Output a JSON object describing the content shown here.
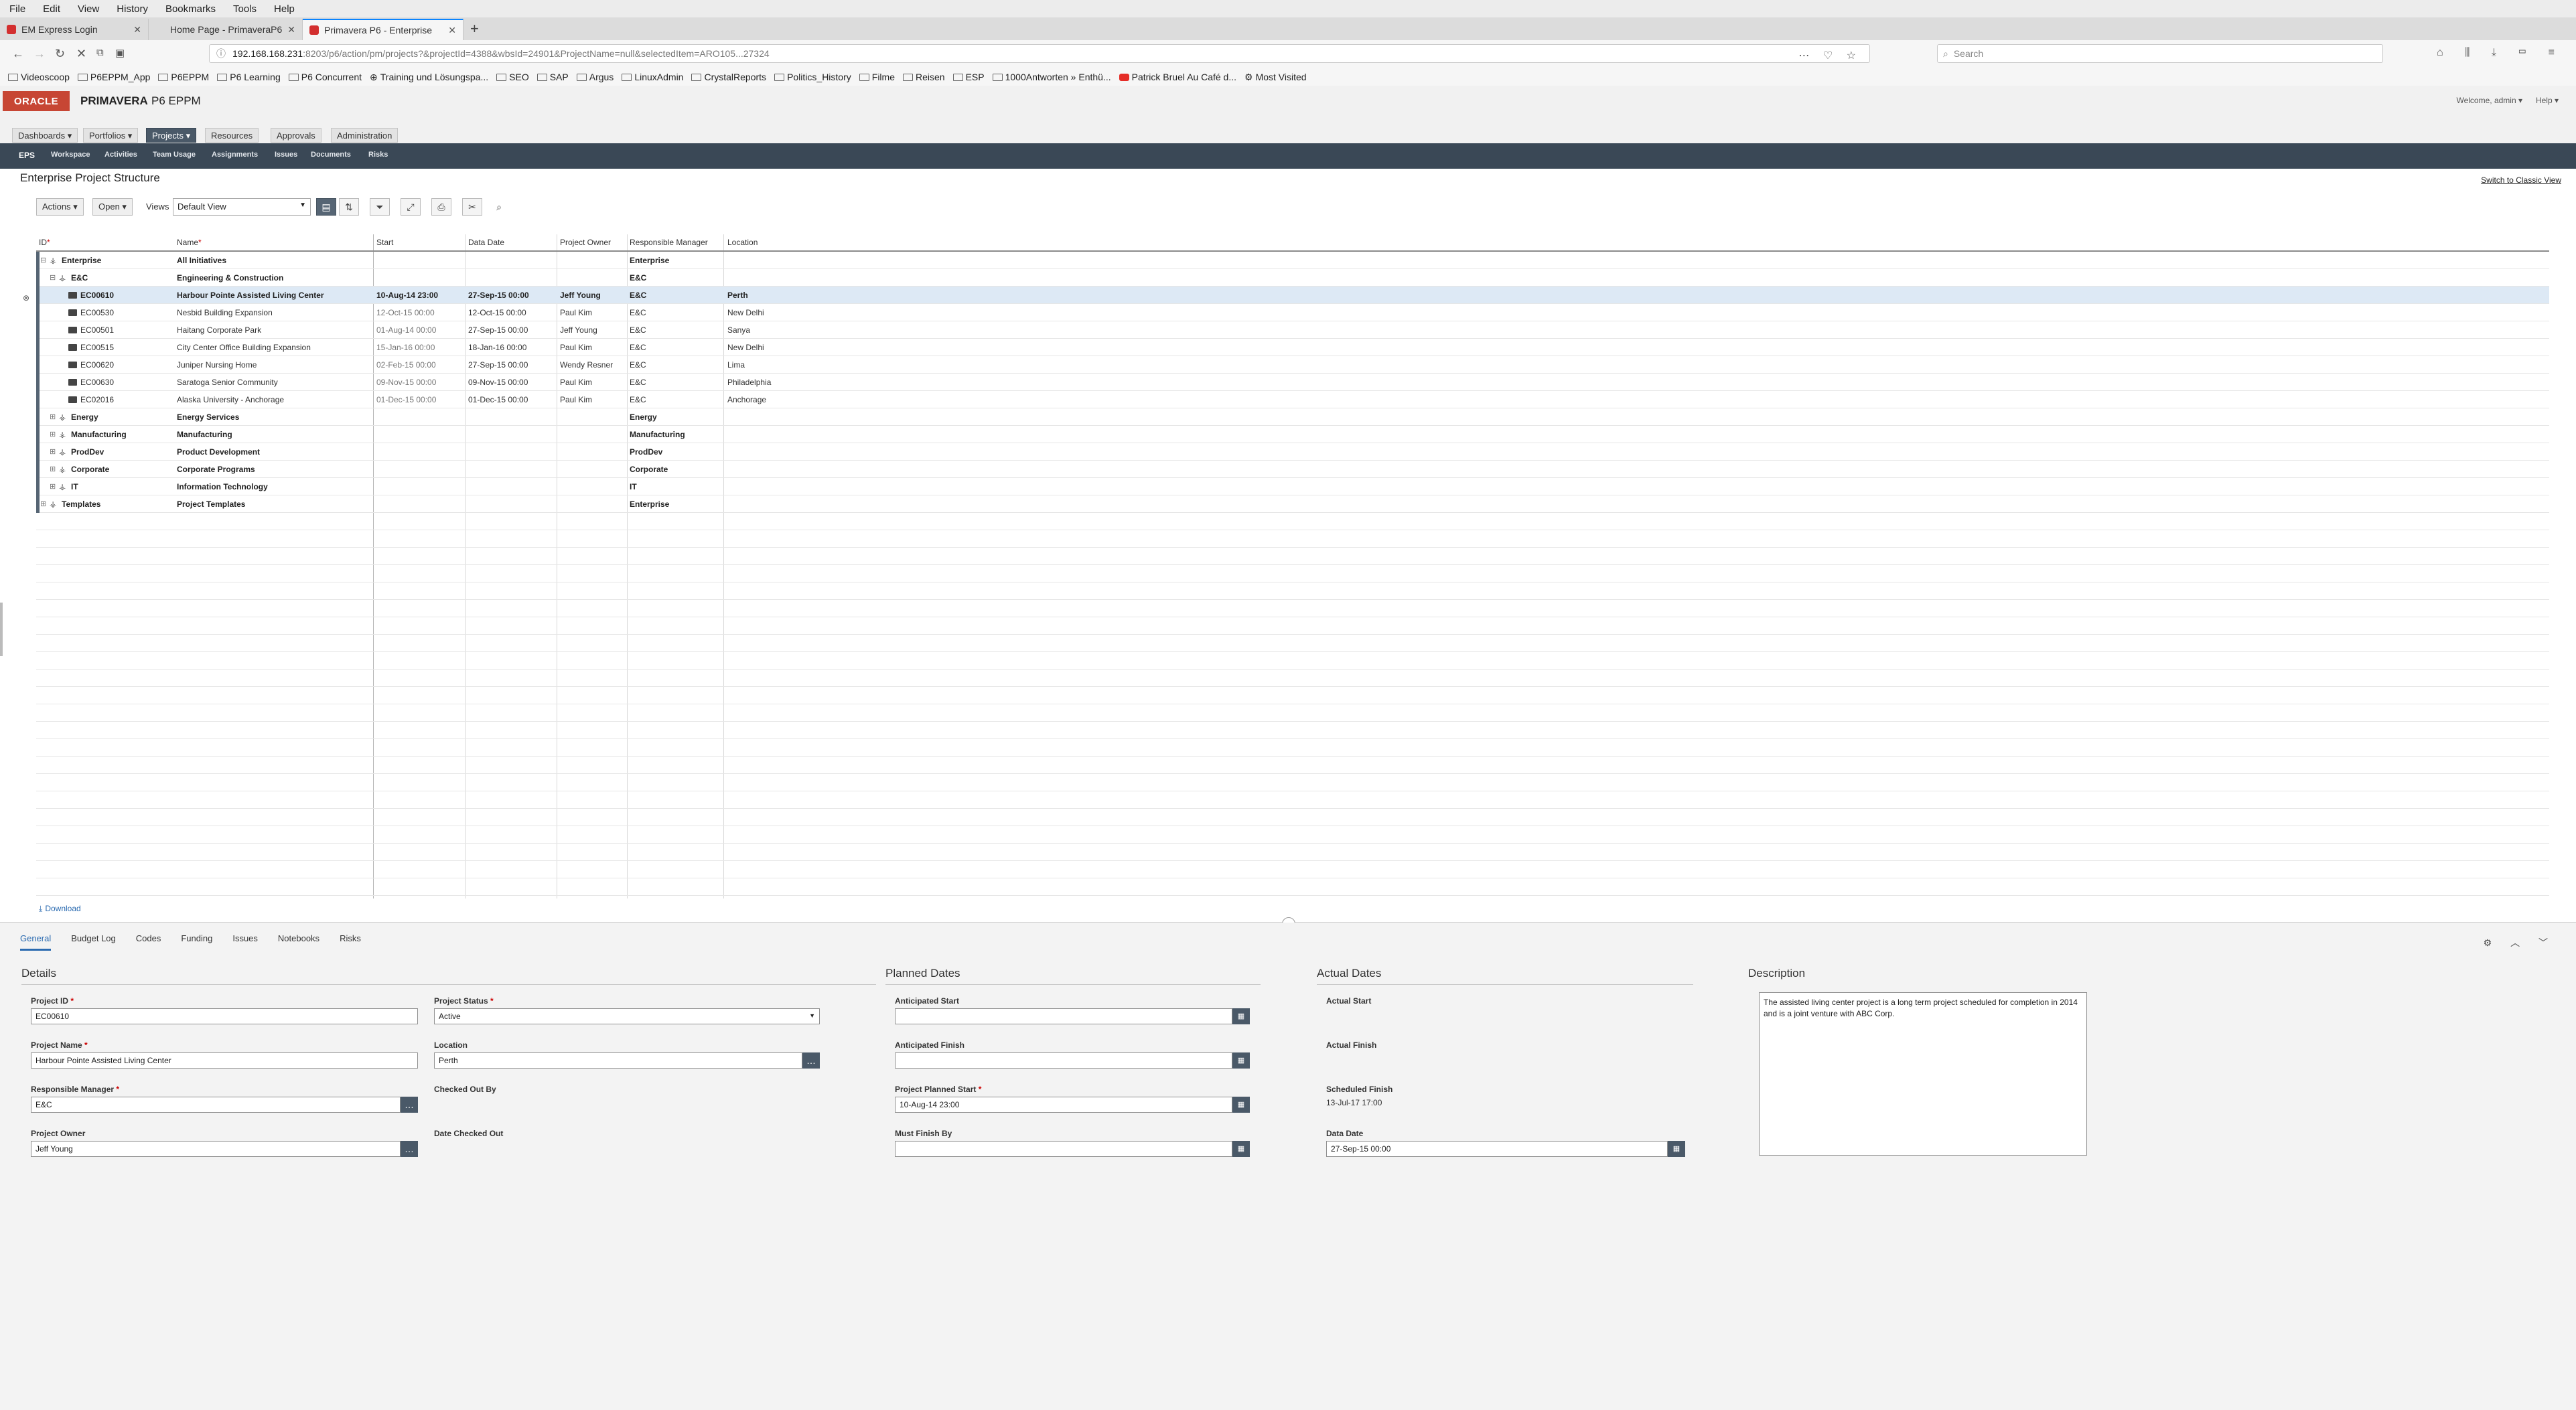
{
  "browser": {
    "menu": [
      "File",
      "Edit",
      "View",
      "History",
      "Bookmarks",
      "Tools",
      "Help"
    ],
    "tabs": [
      {
        "title": "EM Express Login",
        "active": false
      },
      {
        "title": "Home Page - PrimaveraP6EPPM",
        "active": false
      },
      {
        "title": "Primavera P6 - Enterprise",
        "active": true
      }
    ],
    "url_host": "192.168.168.231",
    "url_path": ":8203/p6/action/pm/projects?&projectId=4388&wbsId=24901&ProjectName=null&selectedItem=ARO105...27324",
    "search_placeholder": "Search",
    "bookmarks": [
      "Videoscoop",
      "P6EPPM_App",
      "P6EPPM",
      "P6 Learning",
      "P6 Concurrent",
      "Training und Lösungspa...",
      "SEO",
      "SAP",
      "Argus",
      "LinuxAdmin",
      "CrystalReports",
      "Politics_History",
      "Filme",
      "Reisen",
      "ESP",
      "1000Antworten » Enthü...",
      "Patrick Bruel Au Café d...",
      "Most Visited"
    ]
  },
  "app": {
    "logo": "ORACLE",
    "product_name": "PRIMAVERA",
    "product_edition": "P6 EPPM",
    "welcome": "Welcome, admin ▾",
    "help": "Help ▾",
    "modules": [
      "Dashboards ▾",
      "Portfolios ▾",
      "Projects ▾",
      "Resources",
      "Approvals",
      "Administration"
    ],
    "subnav": [
      "EPS",
      "Workspace",
      "Activities",
      "Team Usage",
      "Assignments",
      "Issues",
      "Documents",
      "Risks"
    ]
  },
  "eps": {
    "title": "Enterprise Project Structure",
    "classic_link": "Switch to Classic View",
    "actions": "Actions ▾",
    "open": "Open ▾",
    "views_label": "Views",
    "view_selected": "Default View",
    "columns": [
      {
        "label": "ID",
        "required": true
      },
      {
        "label": "Name",
        "required": true
      },
      {
        "label": "Start",
        "required": false
      },
      {
        "label": "Data Date",
        "required": false
      },
      {
        "label": "Project Owner",
        "required": false
      },
      {
        "label": "Responsible Manager",
        "required": false
      },
      {
        "label": "Location",
        "required": false
      }
    ],
    "rows": [
      {
        "level": 0,
        "type": "eps",
        "toggle": "⊟",
        "id": "Enterprise",
        "name": "All Initiatives",
        "start": "",
        "data_date": "",
        "owner": "",
        "manager": "Enterprise",
        "location": "",
        "bold": true
      },
      {
        "level": 1,
        "type": "eps",
        "toggle": "⊟",
        "id": "E&C",
        "name": "Engineering & Construction",
        "start": "",
        "data_date": "",
        "owner": "",
        "manager": "E&C",
        "location": "",
        "bold": true
      },
      {
        "level": 2,
        "type": "project",
        "toggle": "",
        "id": "EC00610",
        "name": "Harbour Pointe Assisted Living Center",
        "start": "10-Aug-14 23:00",
        "data_date": "27-Sep-15 00:00",
        "owner": "Jeff Young",
        "manager": "E&C",
        "location": "Perth",
        "bold": true,
        "selected": true
      },
      {
        "level": 2,
        "type": "project",
        "toggle": "",
        "id": "EC00530",
        "name": "Nesbid Building Expansion",
        "start": "12-Oct-15 00:00",
        "data_date": "12-Oct-15 00:00",
        "owner": "Paul Kim",
        "manager": "E&C",
        "location": "New Delhi"
      },
      {
        "level": 2,
        "type": "project",
        "toggle": "",
        "id": "EC00501",
        "name": "Haitang Corporate Park",
        "start": "01-Aug-14 00:00",
        "data_date": "27-Sep-15 00:00",
        "owner": "Jeff Young",
        "manager": "E&C",
        "location": "Sanya"
      },
      {
        "level": 2,
        "type": "project",
        "toggle": "",
        "id": "EC00515",
        "name": "City Center Office Building Expansion",
        "start": "15-Jan-16 00:00",
        "data_date": "18-Jan-16 00:00",
        "owner": "Paul Kim",
        "manager": "E&C",
        "location": "New Delhi"
      },
      {
        "level": 2,
        "type": "project",
        "toggle": "",
        "id": "EC00620",
        "name": "Juniper Nursing Home",
        "start": "02-Feb-15 00:00",
        "data_date": "27-Sep-15 00:00",
        "owner": "Wendy Resner",
        "manager": "E&C",
        "location": "Lima"
      },
      {
        "level": 2,
        "type": "project",
        "toggle": "",
        "id": "EC00630",
        "name": "Saratoga Senior Community",
        "start": "09-Nov-15 00:00",
        "data_date": "09-Nov-15 00:00",
        "owner": "Paul Kim",
        "manager": "E&C",
        "location": "Philadelphia"
      },
      {
        "level": 2,
        "type": "project",
        "toggle": "",
        "id": "EC02016",
        "name": "Alaska University - Anchorage",
        "start": "01-Dec-15 00:00",
        "data_date": "01-Dec-15 00:00",
        "owner": "Paul Kim",
        "manager": "E&C",
        "location": "Anchorage"
      },
      {
        "level": 1,
        "type": "eps",
        "toggle": "⊞",
        "id": "Energy",
        "name": "Energy Services",
        "start": "",
        "data_date": "",
        "owner": "",
        "manager": "Energy",
        "location": "",
        "bold": true
      },
      {
        "level": 1,
        "type": "eps",
        "toggle": "⊞",
        "id": "Manufacturing",
        "name": "Manufacturing",
        "start": "",
        "data_date": "",
        "owner": "",
        "manager": "Manufacturing",
        "location": "",
        "bold": true
      },
      {
        "level": 1,
        "type": "eps",
        "toggle": "⊞",
        "id": "ProdDev",
        "name": "Product Development",
        "start": "",
        "data_date": "",
        "owner": "",
        "manager": "ProdDev",
        "location": "",
        "bold": true
      },
      {
        "level": 1,
        "type": "eps",
        "toggle": "⊞",
        "id": "Corporate",
        "name": "Corporate Programs",
        "start": "",
        "data_date": "",
        "owner": "",
        "manager": "Corporate",
        "location": "",
        "bold": true
      },
      {
        "level": 1,
        "type": "eps",
        "toggle": "⊞",
        "id": "IT",
        "name": "Information Technology",
        "start": "",
        "data_date": "",
        "owner": "",
        "manager": "IT",
        "location": "",
        "bold": true
      },
      {
        "level": 0,
        "type": "eps",
        "toggle": "⊞",
        "id": "Templates",
        "name": "Project Templates",
        "start": "",
        "data_date": "",
        "owner": "",
        "manager": "Enterprise",
        "location": "",
        "bold": true
      }
    ],
    "download": "Download"
  },
  "details": {
    "tabs": [
      "General",
      "Budget Log",
      "Codes",
      "Funding",
      "Issues",
      "Notebooks",
      "Risks"
    ],
    "sections": {
      "details": "Details",
      "planned": "Planned Dates",
      "actual": "Actual Dates",
      "description": "Description"
    },
    "fields": {
      "project_id_label": "Project ID",
      "project_id": "EC00610",
      "project_status_label": "Project Status",
      "project_status": "Active",
      "project_name_label": "Project Name",
      "project_name": "Harbour Pointe Assisted Living Center",
      "location_label": "Location",
      "location": "Perth",
      "resp_manager_label": "Responsible Manager",
      "resp_manager": "E&C",
      "checked_out_by_label": "Checked Out By",
      "project_owner_label": "Project Owner",
      "project_owner": "Jeff Young",
      "date_checked_out_label": "Date Checked Out",
      "anticipated_start_label": "Anticipated Start",
      "anticipated_finish_label": "Anticipated Finish",
      "planned_start_label": "Project Planned Start",
      "planned_start": "10-Aug-14 23:00",
      "must_finish_label": "Must Finish By",
      "actual_start_label": "Actual Start",
      "actual_finish_label": "Actual Finish",
      "scheduled_finish_label": "Scheduled Finish",
      "scheduled_finish": "13-Jul-17 17:00",
      "data_date_label": "Data Date",
      "data_date": "27-Sep-15 00:00"
    },
    "description": "The assisted living center project is a long term project scheduled for completion in 2014 and is a joint venture with ABC Corp."
  }
}
